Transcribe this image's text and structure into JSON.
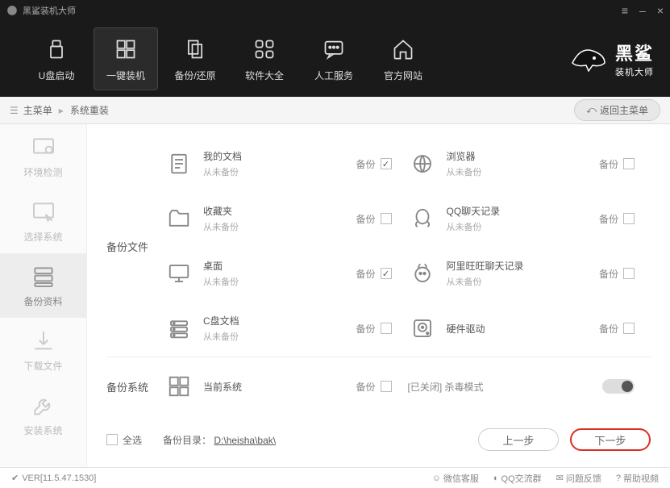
{
  "titlebar": {
    "title": "黑鲨装机大师"
  },
  "topnav": {
    "items": [
      {
        "label": "U盘启动"
      },
      {
        "label": "一键装机"
      },
      {
        "label": "备份/还原"
      },
      {
        "label": "软件大全"
      },
      {
        "label": "人工服务"
      },
      {
        "label": "官方网站"
      }
    ]
  },
  "logo": {
    "main": "黑鲨",
    "sub": "装机大师"
  },
  "breadcrumb": {
    "root": "主菜单",
    "current": "系统重装",
    "back": "返回主菜单"
  },
  "sidebar": {
    "items": [
      {
        "label": "环境检测"
      },
      {
        "label": "选择系统"
      },
      {
        "label": "备份资料"
      },
      {
        "label": "下载文件"
      },
      {
        "label": "安装系统"
      }
    ]
  },
  "sections": {
    "files_label": "备份文件",
    "system_label": "备份系统"
  },
  "items": {
    "docs": {
      "title": "我的文档",
      "sub": "从未备份",
      "action": "备份",
      "checked": true
    },
    "browser": {
      "title": "浏览器",
      "sub": "从未备份",
      "action": "备份",
      "checked": false
    },
    "fav": {
      "title": "收藏夹",
      "sub": "从未备份",
      "action": "备份",
      "checked": false
    },
    "qq": {
      "title": "QQ聊天记录",
      "sub": "从未备份",
      "action": "备份",
      "checked": false
    },
    "desktop": {
      "title": "桌面",
      "sub": "从未备份",
      "action": "备份",
      "checked": true
    },
    "aliww": {
      "title": "阿里旺旺聊天记录",
      "sub": "从未备份",
      "action": "备份",
      "checked": false
    },
    "cdrive": {
      "title": "C盘文档",
      "sub": "从未备份",
      "action": "备份",
      "checked": false
    },
    "driver": {
      "title": "硬件驱动",
      "action": "备份",
      "checked": false
    },
    "cursys": {
      "title": "当前系统",
      "action": "备份",
      "checked": false
    }
  },
  "antivirus": {
    "label": "[已关闭] 杀毒模式"
  },
  "bottom": {
    "select_all": "全选",
    "path_label": "备份目录：",
    "path_value": "D:\\heisha\\bak\\",
    "prev": "上一步",
    "next": "下一步"
  },
  "statusbar": {
    "version": "VER[11.5.47.1530]",
    "links": [
      {
        "label": "微信客服"
      },
      {
        "label": "QQ交流群"
      },
      {
        "label": "问题反馈"
      },
      {
        "label": "帮助视频"
      }
    ]
  }
}
